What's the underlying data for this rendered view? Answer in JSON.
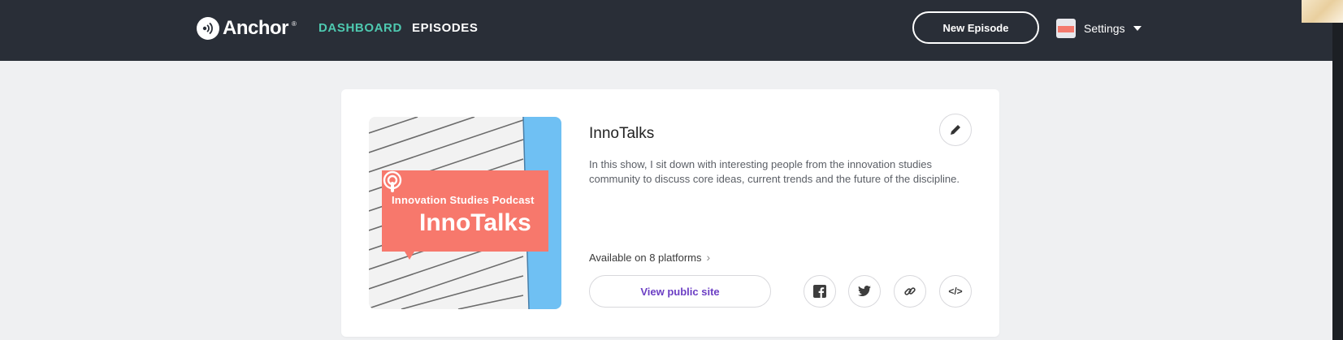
{
  "app": {
    "brand": "Anchor"
  },
  "nav": {
    "dashboard_label": "DASHBOARD",
    "episodes_label": "EPISODES",
    "new_episode_label": "New Episode",
    "settings_label": "Settings"
  },
  "show": {
    "cover": {
      "subtitle": "Innovation Studies Podcast",
      "title": "InnoTalks"
    },
    "title": "InnoTalks",
    "description": "In this show, I sit down with interesting people from the innovation studies community to discuss core ideas, current trends and the future of the discipline.",
    "platforms_label": "Available on 8 platforms",
    "view_public_site_label": "View public site"
  },
  "share_icons": [
    "facebook-icon",
    "twitter-icon",
    "link-icon",
    "embed-code-icon"
  ],
  "colors": {
    "topbar": "#292e37",
    "accent_teal": "#4ec9b0",
    "link_purple": "#6c3fc4",
    "cover_coral": "#f7786c",
    "cover_blue": "#6fc0f3"
  }
}
